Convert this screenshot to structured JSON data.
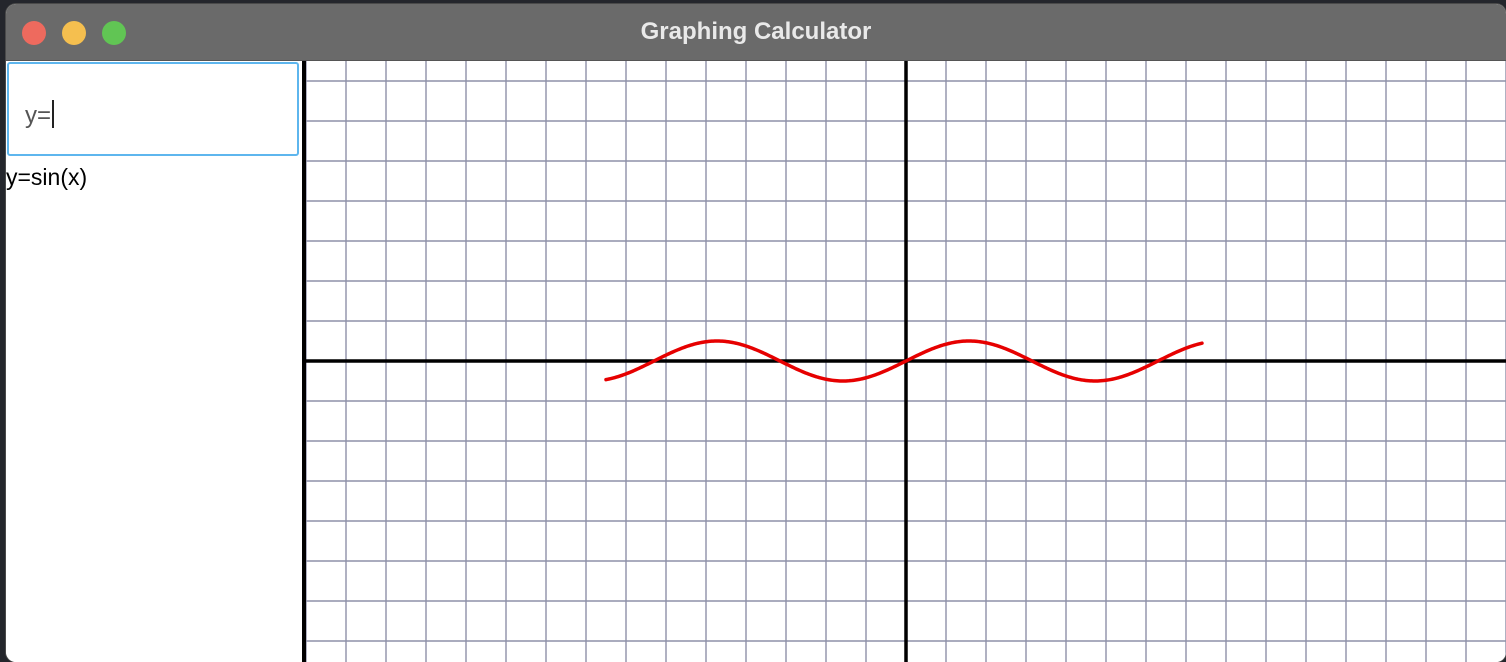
{
  "window": {
    "title": "Graphing Calculator"
  },
  "sidebar": {
    "input_prompt": "y=",
    "equations": [
      "y=sin(x)"
    ]
  },
  "graph": {
    "function": "sin(x)",
    "curve_color": "#e60000",
    "grid_color": "#8e90a8",
    "axis_color": "#000000",
    "x_range": [
      -7.5,
      7.5
    ],
    "y_range": [
      -3.75,
      3.75
    ],
    "plotted_domain": [
      -3.75,
      3.7
    ]
  }
}
